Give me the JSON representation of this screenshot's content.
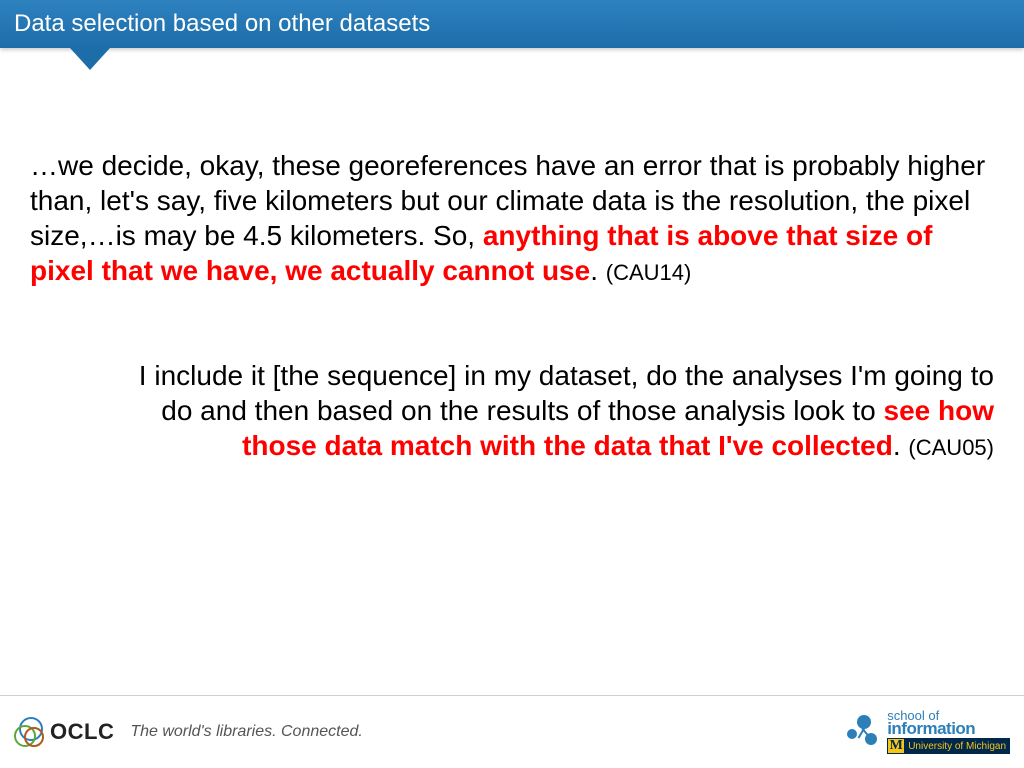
{
  "header": {
    "title": "Data selection based on other datasets"
  },
  "quote1": {
    "pre": "…we decide, okay, these georeferences have an error that is probably higher than, let's say, five kilometers but our climate data is the resolution, the pixel size,…is may be 4.5 kilometers. So, ",
    "highlight": "anything that is above that size of pixel that we have, we actually cannot use",
    "post": ". ",
    "cite": "(CAU14)"
  },
  "quote2": {
    "pre": "I include it [the sequence] in my dataset, do the analyses I'm going to do and then based on the results of those analysis look to ",
    "highlight": "see how those data match with the data that I've collected",
    "post": ". ",
    "cite": "(CAU05)"
  },
  "footer": {
    "oclc_brand": "OCLC",
    "tagline": "The world's libraries. Connected.",
    "si_top": "school of",
    "si_bottom": "information",
    "um_label": "University of Michigan",
    "um_m": "M"
  }
}
